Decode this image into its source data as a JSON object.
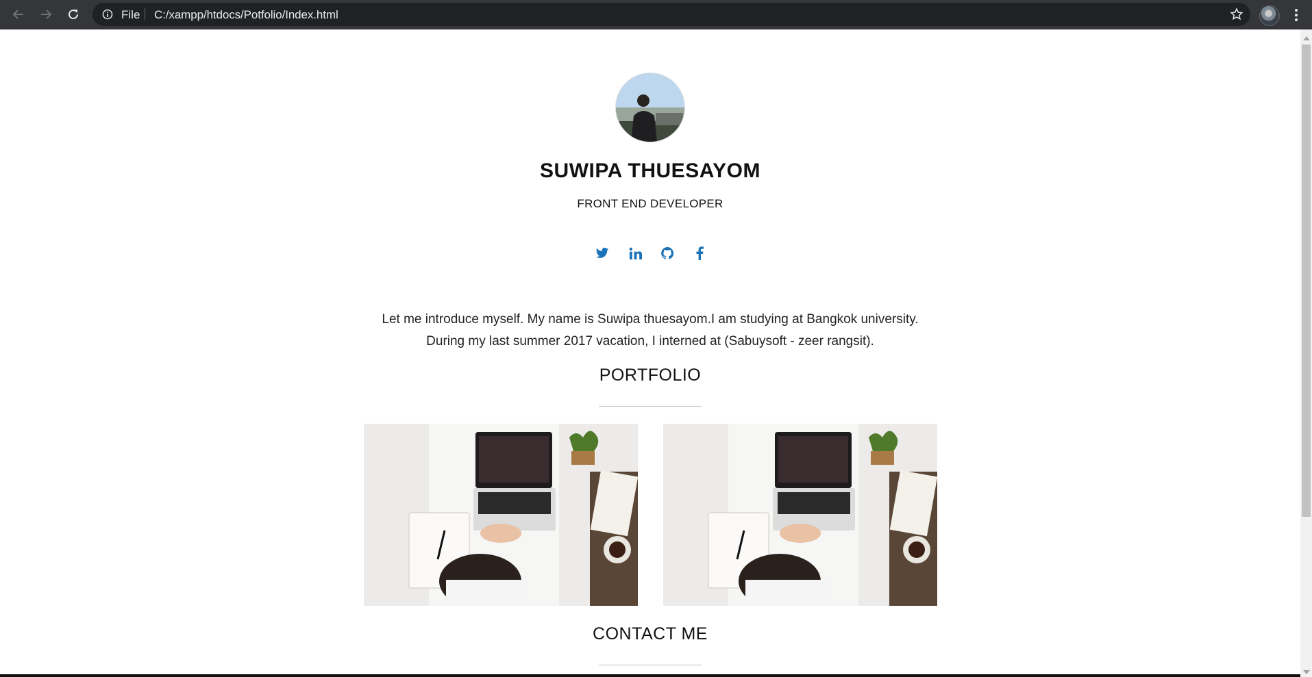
{
  "browser": {
    "scheme_label": "File",
    "url": "C:/xampp/htdocs/Potfolio/Index.html"
  },
  "profile": {
    "name": "SUWIPA THUESAYOM",
    "role": "FRONT END DEVELOPER"
  },
  "socials": [
    {
      "icon": "twitter-icon"
    },
    {
      "icon": "linkedin-icon"
    },
    {
      "icon": "github-icon"
    },
    {
      "icon": "facebook-icon"
    }
  ],
  "intro": {
    "line1": "Let me introduce myself. My name is Suwipa thuesayom.I am studying at Bangkok university.",
    "line2": "During my last summer 2017 vacation, I interned at (Sabuysoft - zeer rangsit)."
  },
  "sections": {
    "portfolio": "PORTFOLIO",
    "contact": "CONTACT ME"
  },
  "colors": {
    "accent": "#1a73b8",
    "chrome": "#35363a",
    "omnibox": "#202124"
  }
}
